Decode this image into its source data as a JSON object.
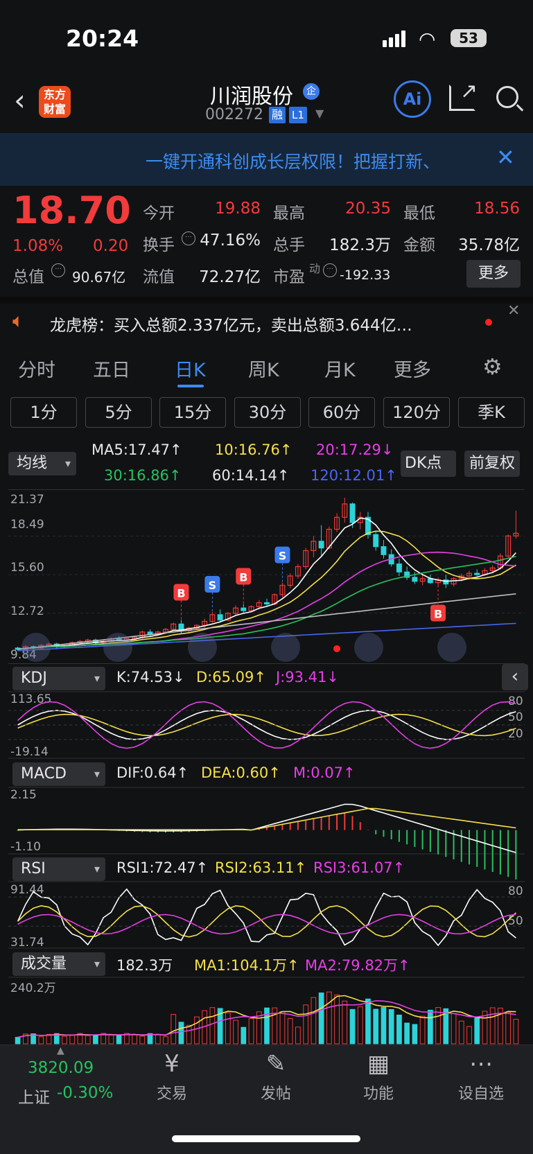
{
  "status": {
    "time": "20:24",
    "battery": "53"
  },
  "header": {
    "brand_top": "东方",
    "brand_bottom": "财富",
    "stock_name": "川润股份",
    "badge_qi": "企",
    "code": "002272",
    "tag_rong": "融",
    "tag_l1": "L1",
    "ai": "Ai"
  },
  "banner": {
    "text": "一键开通科创成长层权限！把握打新、"
  },
  "quote": {
    "price": "18.70",
    "pct": "1.08%",
    "chg": "0.20",
    "rows": [
      {
        "l1": "今开",
        "v1": "19.88",
        "l2": "最高",
        "v2": "20.35",
        "l3": "最低",
        "v3": "18.56"
      },
      {
        "l1": "换手",
        "v1": "47.16%",
        "l2": "总手",
        "v2": "182.3万",
        "l3": "金额",
        "v3": "35.78亿"
      }
    ],
    "zongzhi_label": "总值",
    "zongzhi": "90.67亿",
    "liuzhi_label": "流值",
    "liuzhi": "72.27亿",
    "shiying_label": "市盈",
    "shiying_sup": "动",
    "shiying": "-192.33",
    "more": "更多"
  },
  "lhb": {
    "text": "龙虎榜：买入总额2.337亿元，卖出总额3.644亿…"
  },
  "tabs": [
    "分时",
    "五日",
    "日K",
    "周K",
    "月K",
    "更多"
  ],
  "periods": [
    "1分",
    "5分",
    "15分",
    "30分",
    "60分",
    "120分",
    "季K"
  ],
  "ma": {
    "select": "均线",
    "ma5": "MA5:17.47↑",
    "ma10": "10:16.76↑",
    "ma20": "20:17.29↓",
    "ma30": "30:16.86↑",
    "ma60": "60:14.14↑",
    "ma120": "120:12.01↑",
    "dk": "DK点",
    "fq": "前复权"
  },
  "kaxis": [
    "21.37",
    "18.49",
    "15.60",
    "12.72",
    "9.84"
  ],
  "kdj": {
    "select": "KDJ",
    "k": "K:74.53↓",
    "d": "D:65.09↑",
    "j": "J:93.41↓",
    "top": "113.65",
    "bottom": "-19.14",
    "r1": "80",
    "r2": "50",
    "r3": "20"
  },
  "macd": {
    "select": "MACD",
    "dif": "DIF:0.64↑",
    "dea": "DEA:0.60↑",
    "m": "M:0.07↑",
    "top": "2.15",
    "bottom": "-1.10"
  },
  "rsi": {
    "select": "RSI",
    "r1": "RSI1:72.47↑",
    "r2": "RSI2:63.11↑",
    "r3": "RSI3:61.07↑",
    "top": "91.44",
    "bottom": "31.74",
    "a1": "80",
    "a2": "50"
  },
  "vol": {
    "select": "成交量",
    "v": "182.3万",
    "ma1": "MA1:104.1万↑",
    "ma2": "MA2:79.82万↑",
    "top": "240.2万"
  },
  "bottom": {
    "index_value": "3820.09",
    "index_name": "上证",
    "index_pct": "-0.30%",
    "nav": [
      "交易",
      "发帖",
      "功能",
      "设自选"
    ]
  },
  "colors": {
    "up": "#f23b3b",
    "down": "#2cd3d8",
    "ma5": "#ffffff",
    "ma10": "#f5e04b",
    "ma20": "#e640e6",
    "ma30": "#26c25f",
    "ma60": "#bfbfbf",
    "ma120": "#4a66f0"
  },
  "chart_data": {
    "type": "candlestick",
    "ylim": [
      9.84,
      21.37
    ],
    "ohlc": [
      [
        10.1,
        10.2,
        9.9,
        10.0
      ],
      [
        10.0,
        10.3,
        9.9,
        10.2
      ],
      [
        10.2,
        10.3,
        10.0,
        10.1
      ],
      [
        10.1,
        10.4,
        10.0,
        10.3
      ],
      [
        10.3,
        10.5,
        10.2,
        10.4
      ],
      [
        10.4,
        10.5,
        10.1,
        10.2
      ],
      [
        10.2,
        10.4,
        10.1,
        10.3
      ],
      [
        10.3,
        10.6,
        10.2,
        10.5
      ],
      [
        10.5,
        10.7,
        10.4,
        10.6
      ],
      [
        10.6,
        10.8,
        10.5,
        10.7
      ],
      [
        10.7,
        10.8,
        10.4,
        10.5
      ],
      [
        10.5,
        10.7,
        10.4,
        10.6
      ],
      [
        10.6,
        10.9,
        10.5,
        10.8
      ],
      [
        10.8,
        11.0,
        10.6,
        10.7
      ],
      [
        10.7,
        10.9,
        10.5,
        10.8
      ],
      [
        10.8,
        11.0,
        10.6,
        10.9
      ],
      [
        10.9,
        11.4,
        10.8,
        11.3
      ],
      [
        11.3,
        11.5,
        11.0,
        11.1
      ],
      [
        11.1,
        11.4,
        11.0,
        11.3
      ],
      [
        11.3,
        11.6,
        11.2,
        11.5
      ],
      [
        11.5,
        12.0,
        11.4,
        11.9
      ],
      [
        11.9,
        12.2,
        11.2,
        11.4
      ],
      [
        11.4,
        11.7,
        11.2,
        11.6
      ],
      [
        11.6,
        11.9,
        11.5,
        11.8
      ],
      [
        11.8,
        12.3,
        11.6,
        12.1
      ],
      [
        12.1,
        12.8,
        12.0,
        12.6
      ],
      [
        12.6,
        13.0,
        12.0,
        12.2
      ],
      [
        12.2,
        12.8,
        12.1,
        12.7
      ],
      [
        12.7,
        13.3,
        12.5,
        13.1
      ],
      [
        13.1,
        13.4,
        12.7,
        12.9
      ],
      [
        12.9,
        13.3,
        12.8,
        13.2
      ],
      [
        13.2,
        13.7,
        13.0,
        13.5
      ],
      [
        13.5,
        13.8,
        13.2,
        13.4
      ],
      [
        13.4,
        14.2,
        13.3,
        14.1
      ],
      [
        14.1,
        15.0,
        13.9,
        14.8
      ],
      [
        14.8,
        15.7,
        14.6,
        15.5
      ],
      [
        15.5,
        16.4,
        15.3,
        16.2
      ],
      [
        16.2,
        17.6,
        16.0,
        17.4
      ],
      [
        17.4,
        18.5,
        16.9,
        18.1
      ],
      [
        18.1,
        19.3,
        17.0,
        17.6
      ],
      [
        17.6,
        19.2,
        17.5,
        19.0
      ],
      [
        19.0,
        20.2,
        18.8,
        19.9
      ],
      [
        19.9,
        21.37,
        19.5,
        20.9
      ],
      [
        20.9,
        21.0,
        19.1,
        19.5
      ],
      [
        19.5,
        20.3,
        19.0,
        19.9
      ],
      [
        19.9,
        20.3,
        18.3,
        18.6
      ],
      [
        18.6,
        18.9,
        17.4,
        17.7
      ],
      [
        17.7,
        18.2,
        16.8,
        17.1
      ],
      [
        17.1,
        17.5,
        16.2,
        16.4
      ],
      [
        16.4,
        16.8,
        15.5,
        15.8
      ],
      [
        15.8,
        16.2,
        15.2,
        15.4
      ],
      [
        15.4,
        15.8,
        14.9,
        15.1
      ],
      [
        15.1,
        15.6,
        14.8,
        15.3
      ],
      [
        15.3,
        15.6,
        14.9,
        15.0
      ],
      [
        15.0,
        15.4,
        14.8,
        15.2
      ],
      [
        15.2,
        15.6,
        14.6,
        14.9
      ],
      [
        14.9,
        15.4,
        14.7,
        15.3
      ],
      [
        15.3,
        15.7,
        15.1,
        15.5
      ],
      [
        15.5,
        15.9,
        15.2,
        15.7
      ],
      [
        15.7,
        16.0,
        15.4,
        15.6
      ],
      [
        15.6,
        16.1,
        15.5,
        15.9
      ],
      [
        15.9,
        16.3,
        15.7,
        16.1
      ],
      [
        16.1,
        17.2,
        16.0,
        17.0
      ],
      [
        17.0,
        18.6,
        16.9,
        18.5
      ],
      [
        18.5,
        20.4,
        18.3,
        18.7
      ]
    ]
  }
}
